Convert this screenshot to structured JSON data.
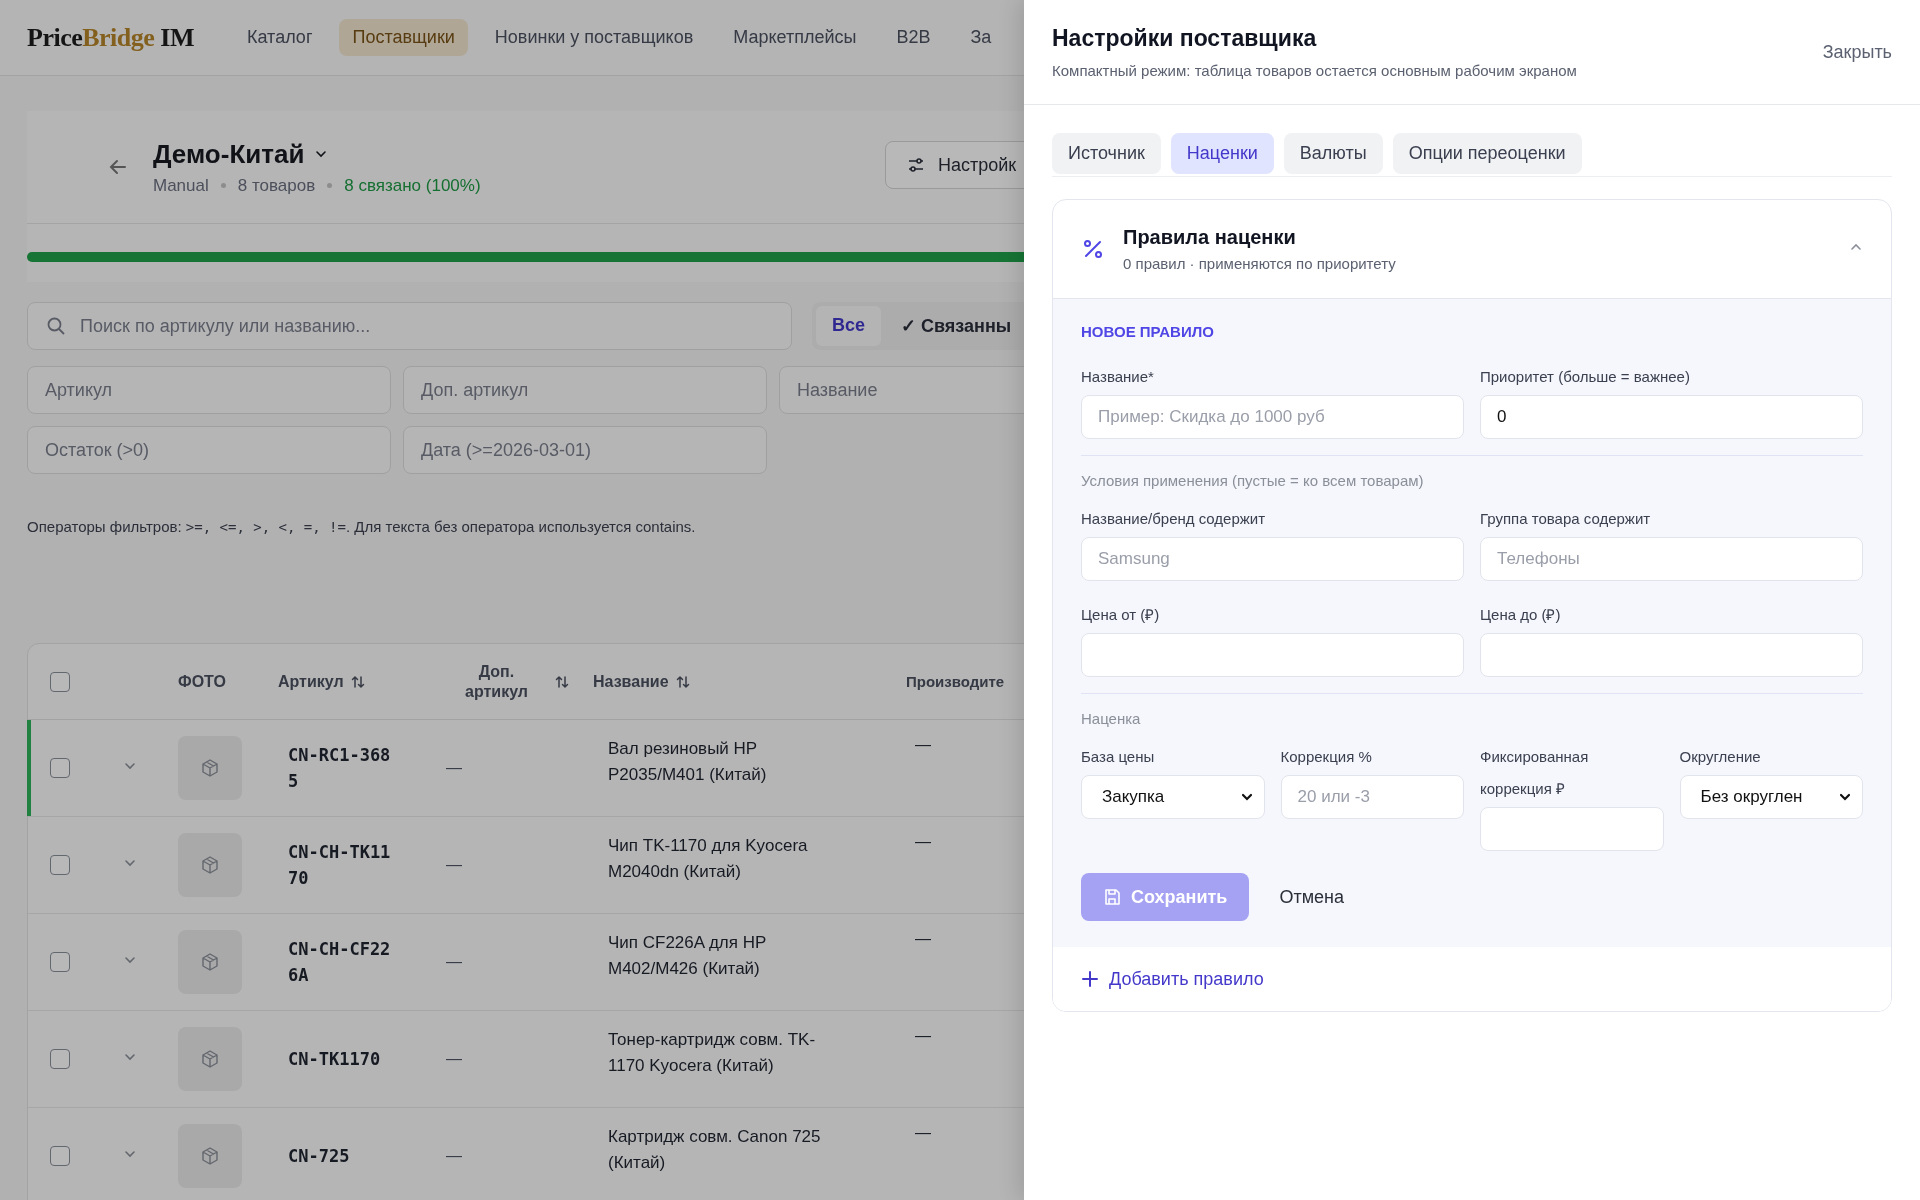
{
  "nav": {
    "logo": {
      "first": "Price",
      "accent": "Bridge",
      "last": "IM"
    },
    "items": [
      {
        "label": "Каталог",
        "selected": false
      },
      {
        "label": "Поставщики",
        "selected": true
      },
      {
        "label": "Новинки у поставщиков",
        "selected": false
      },
      {
        "label": "Маркетплейсы",
        "selected": false
      },
      {
        "label": "B2B",
        "selected": false
      },
      {
        "label": "За",
        "selected": false
      }
    ]
  },
  "supplier": {
    "title": "Демо-Китай",
    "meta": [
      "Manual",
      "8 товаров"
    ],
    "linked": "8 связано (100%)",
    "settings_button": "Настройк",
    "progress": {
      "level": 1
    }
  },
  "search": {
    "placeholder": "Поиск по артикулу или названию..."
  },
  "segments": [
    {
      "label": "Все",
      "selected": true
    },
    {
      "label": "✓ Связанны",
      "selected": false
    }
  ],
  "filters": [
    "Артикул",
    "Доп. артикул",
    "Название",
    "Остаток (>0)",
    "Дата (>=2026-03-01)"
  ],
  "filter_help": {
    "text": "Операторы фильтров:",
    "operators": ">=,  <=,  >,  <,  =,  !=",
    "suffix": ". Для текста без оператора используется contains."
  },
  "table": {
    "select_all": {
      "checked": false
    },
    "columns": [
      {
        "label": "ФОТО",
        "sortable": false
      },
      {
        "label": "Артикул",
        "sortable": true
      },
      {
        "label": "Доп. артикул",
        "sortable": true
      },
      {
        "label": "Название",
        "sortable": true
      },
      {
        "label": "Производите",
        "sortable": false
      }
    ],
    "rows": [
      {
        "checked": false,
        "highlighted": true,
        "sku": "CN-RC1-3685",
        "extra_sku": "—",
        "name": "Вал резиновый HP P2035/M401 (Китай)",
        "producer": "—"
      },
      {
        "checked": false,
        "highlighted": false,
        "sku": "CN-CH-TK1170",
        "extra_sku": "—",
        "name": "Чип TK-1170 для Kyocera M2040dn (Китай)",
        "producer": "—"
      },
      {
        "checked": false,
        "highlighted": false,
        "sku": "CN-CH-CF226A",
        "extra_sku": "—",
        "name": "Чип CF226A для HP M402/M426 (Китай)",
        "producer": "—"
      },
      {
        "checked": false,
        "highlighted": false,
        "sku": "CN-TK1170",
        "extra_sku": "—",
        "name": "Тонер-картридж совм. TK-1170 Kyocera (Китай)",
        "producer": "—"
      },
      {
        "checked": false,
        "highlighted": false,
        "sku": "CN-725",
        "extra_sku": "—",
        "name": "Картридж совм. Canon 725 (Китай)",
        "producer": "—"
      }
    ]
  },
  "drawer": {
    "title": "Настройки поставщика",
    "subtitle": "Компактный режим: таблица товаров остается основным рабочим экраном",
    "close": "Закрыть",
    "tabs": [
      {
        "label": "Источник",
        "selected": false
      },
      {
        "label": "Наценки",
        "selected": true
      },
      {
        "label": "Валюты",
        "selected": false
      },
      {
        "label": "Опции переоценки",
        "selected": false
      }
    ],
    "card": {
      "title": "Правила наценки",
      "subtitle": "0 правил · применяются по приоритету",
      "expanded": true,
      "form_title": "НОВОЕ ПРАВИЛО",
      "sections": [
        {
          "kind": "pair",
          "fields": [
            {
              "kind": "input",
              "label": "Название*",
              "placeholder": "Пример: Скидка до 1000 руб"
            },
            {
              "kind": "input",
              "label": "Приоритет (больше = важнее)",
              "value": "0"
            }
          ]
        },
        {
          "kind": "pair",
          "heading": "Условия применения (пустые = ко всем товарам)",
          "fields": [
            {
              "kind": "input",
              "label": "Название/бренд содержит",
              "placeholder": "Samsung"
            },
            {
              "kind": "input",
              "label": "Группа товара содержит",
              "placeholder": "Телефоны"
            },
            {
              "kind": "input",
              "label": "Цена от (₽)"
            },
            {
              "kind": "input",
              "label": "Цена до (₽)"
            }
          ]
        },
        {
          "kind": "quad",
          "heading": "Наценка",
          "fields": [
            {
              "kind": "select",
              "label": "База цены",
              "value": "Закупка"
            },
            {
              "kind": "input",
              "label": "Коррекция %",
              "placeholder": "20 или -3"
            },
            {
              "kind": "input",
              "label": "Фиксированная коррекция ₽"
            },
            {
              "kind": "select",
              "label": "Округление",
              "value": "Без округлен"
            }
          ]
        }
      ],
      "save": {
        "label": "Сохранить",
        "disabled": true
      },
      "cancel": "Отмена",
      "add_rule": "Добавить правило"
    }
  }
}
